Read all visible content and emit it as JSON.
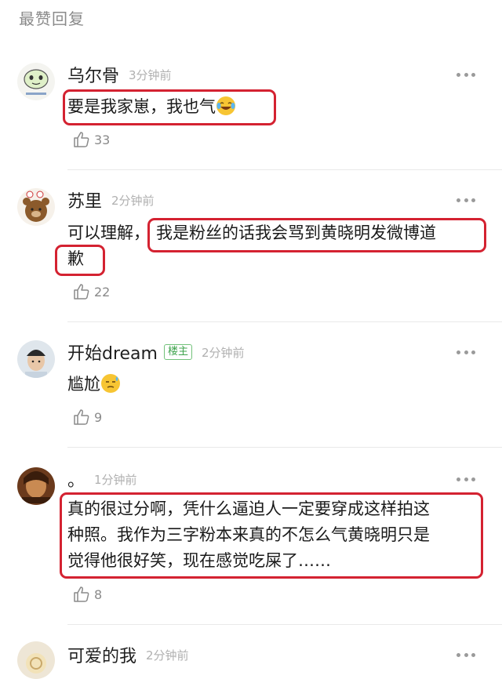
{
  "header": {
    "title": "最赞回复"
  },
  "comments": [
    {
      "name": "乌尔骨",
      "time": "3分钟前",
      "lines": [
        "要是我家崽，我也气"
      ],
      "emoji": "laughing-tears-emoji",
      "likes": "33"
    },
    {
      "name": "苏里",
      "time": "2分钟前",
      "lines": [
        "可以理解，",
        "我是粉丝的话我会骂到黄晓明发微博道",
        "歉"
      ],
      "likes": "22"
    },
    {
      "name": "开始dream",
      "badge": "楼主",
      "time": "2分钟前",
      "lines": [
        "尴尬"
      ],
      "emoji": "cold-sweat-emoji",
      "likes": "9"
    },
    {
      "name": "。",
      "time": "1分钟前",
      "lines": [
        "真的很过分啊，凭什么逼迫人一定要穿成这样拍这",
        "种照。我作为三字粉本来真的不怎么气黄晓明只是",
        "觉得他很好笑，现在感觉吃屎了……"
      ],
      "likes": "8"
    },
    {
      "name": "可爱的我",
      "time": "2分钟前"
    }
  ],
  "colors": {
    "highlight_box": "#d42231",
    "badge_green": "#3fa34d"
  }
}
